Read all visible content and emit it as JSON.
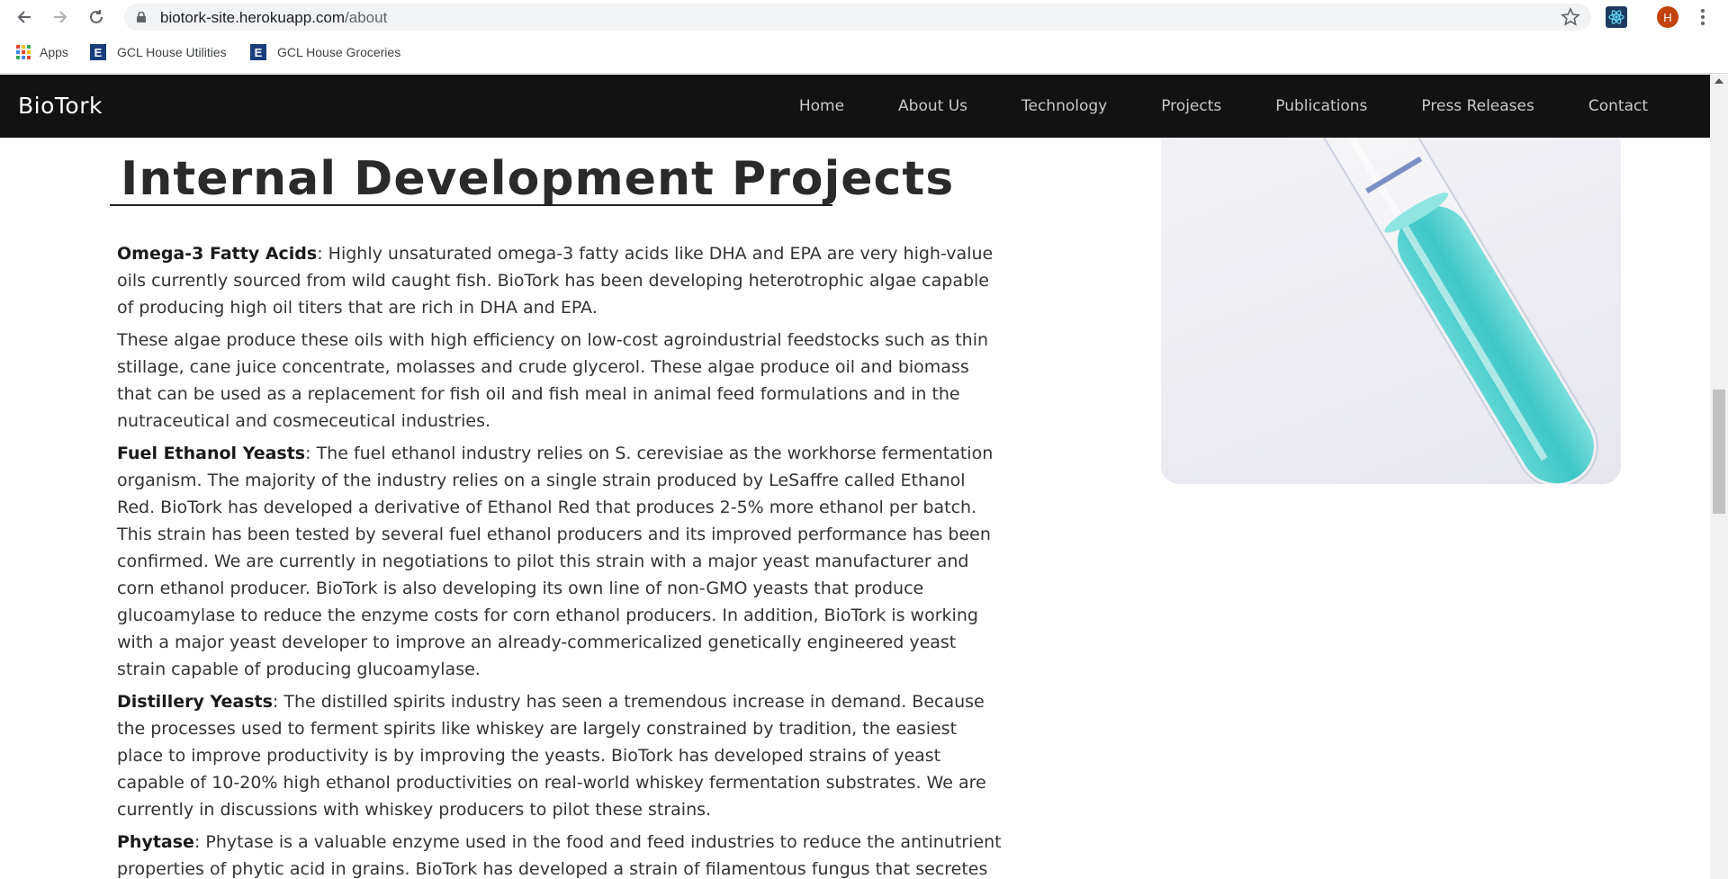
{
  "browser": {
    "url_host": "biotork-site.herokuapp.com",
    "url_path": "/about",
    "profile_initial": "H",
    "bookmarks": [
      {
        "label": "Apps",
        "icon": "apps-grid-icon"
      },
      {
        "label": "GCL House Utilities",
        "icon": "e-icon"
      },
      {
        "label": "GCL House Groceries",
        "icon": "e-icon"
      }
    ]
  },
  "site": {
    "brand": "BioTork",
    "menu": [
      "Home",
      "About Us",
      "Technology",
      "Projects",
      "Publications",
      "Press Releases",
      "Contact"
    ]
  },
  "main": {
    "title": "Internal Development Projects",
    "sections": [
      {
        "heading": "Omega-3 Fatty Acids",
        "text": ": Highly unsaturated omega-3 fatty acids like DHA and EPA are very high-value oils currently sourced from wild caught fish. BioTork has been developing heterotrophic algae capable of producing high oil titers that are rich in DHA and EPA."
      },
      {
        "heading": "",
        "text": "These algae produce these oils with high efficiency on low-cost agroindustrial feedstocks such as thin stillage, cane juice concentrate, molasses and crude glycerol. These algae produce oil and biomass that can be used as a replacement for fish oil and fish meal in animal feed formulations and in the nutraceutical and cosmeceutical industries."
      },
      {
        "heading": "Fuel Ethanol Yeasts",
        "text": ": The fuel ethanol industry relies on S. cerevisiae as the workhorse fermentation organism. The majority of the industry relies on a single strain produced by LeSaffre called Ethanol Red. BioTork has developed a derivative of Ethanol Red that produces 2-5% more ethanol per batch. This strain has been tested by several fuel ethanol producers and its improved performance has been confirmed. We are currently in negotiations to pilot this strain with a major yeast manufacturer and corn ethanol producer. BioTork is also developing its own line of non-GMO yeasts that produce glucoamylase to reduce the enzyme costs for corn ethanol producers. In addition, BioTork is working with a major yeast developer to improve an already-commericalized genetically engineered yeast strain capable of producing glucoamylase."
      },
      {
        "heading": "Distillery Yeasts",
        "text": ": The distilled spirits industry has seen a tremendous increase in demand. Because the processes used to ferment spirits like whiskey are largely constrained by tradition, the easiest place to improve productivity is by improving the yeasts. BioTork has developed strains of yeast capable of 10-20% high ethanol productivities on real-world whiskey fermentation substrates. We are currently in discussions with whiskey producers to pilot these strains."
      },
      {
        "heading": "Phytase",
        "text": ": Phytase is a valuable enzyme used in the food and feed industries to reduce the antinutrient properties of phytic acid in grains. BioTork has developed a strain of filamentous fungus that secretes"
      }
    ]
  },
  "colors": {
    "nav_bg": "#121212",
    "nav_text": "#c9c9c9",
    "accent_teal": "#3ec6c6",
    "avatar": "#c2410c"
  }
}
